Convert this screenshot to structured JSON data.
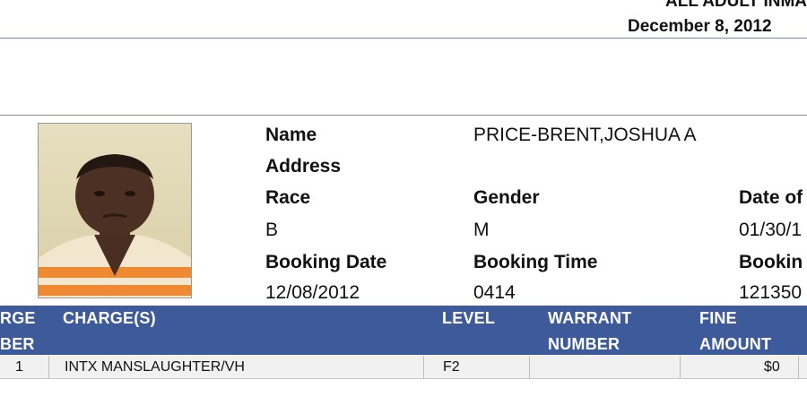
{
  "header": {
    "title": "ALL ADULT INMA",
    "date": "December  8, 2012"
  },
  "inmate": {
    "photo_icon": "booking-photo",
    "labels": {
      "name": "Name",
      "address": "Address",
      "race": "Race",
      "gender": "Gender",
      "dob": "Date of",
      "booking_date": "Booking Date",
      "booking_time": "Booking Time",
      "booking_no": "Bookin"
    },
    "values": {
      "name": "PRICE-BRENT,JOSHUA A",
      "race": "B",
      "gender": "M",
      "dob": "01/30/1",
      "booking_date": "12/08/2012",
      "booking_time": "0414",
      "booking_no": "121350"
    }
  },
  "charges_table": {
    "headers": {
      "charge_number_line1": "RGE",
      "charge_number_line2": "BER",
      "charges": "CHARGE(S)",
      "level": "LEVEL",
      "warrant_line1": "WARRANT",
      "warrant_line2": "NUMBER",
      "fine_line1": "FINE",
      "fine_line2": "AMOUNT"
    },
    "rows": [
      {
        "number": "1",
        "charge": "INTX MANSLAUGHTER/VH",
        "level": "F2",
        "warrant": "",
        "fine": "$0"
      }
    ]
  },
  "colors": {
    "header_band": "#3d5a9b",
    "header_text": "#ffffff",
    "row_bg": "#f1f1f1"
  }
}
